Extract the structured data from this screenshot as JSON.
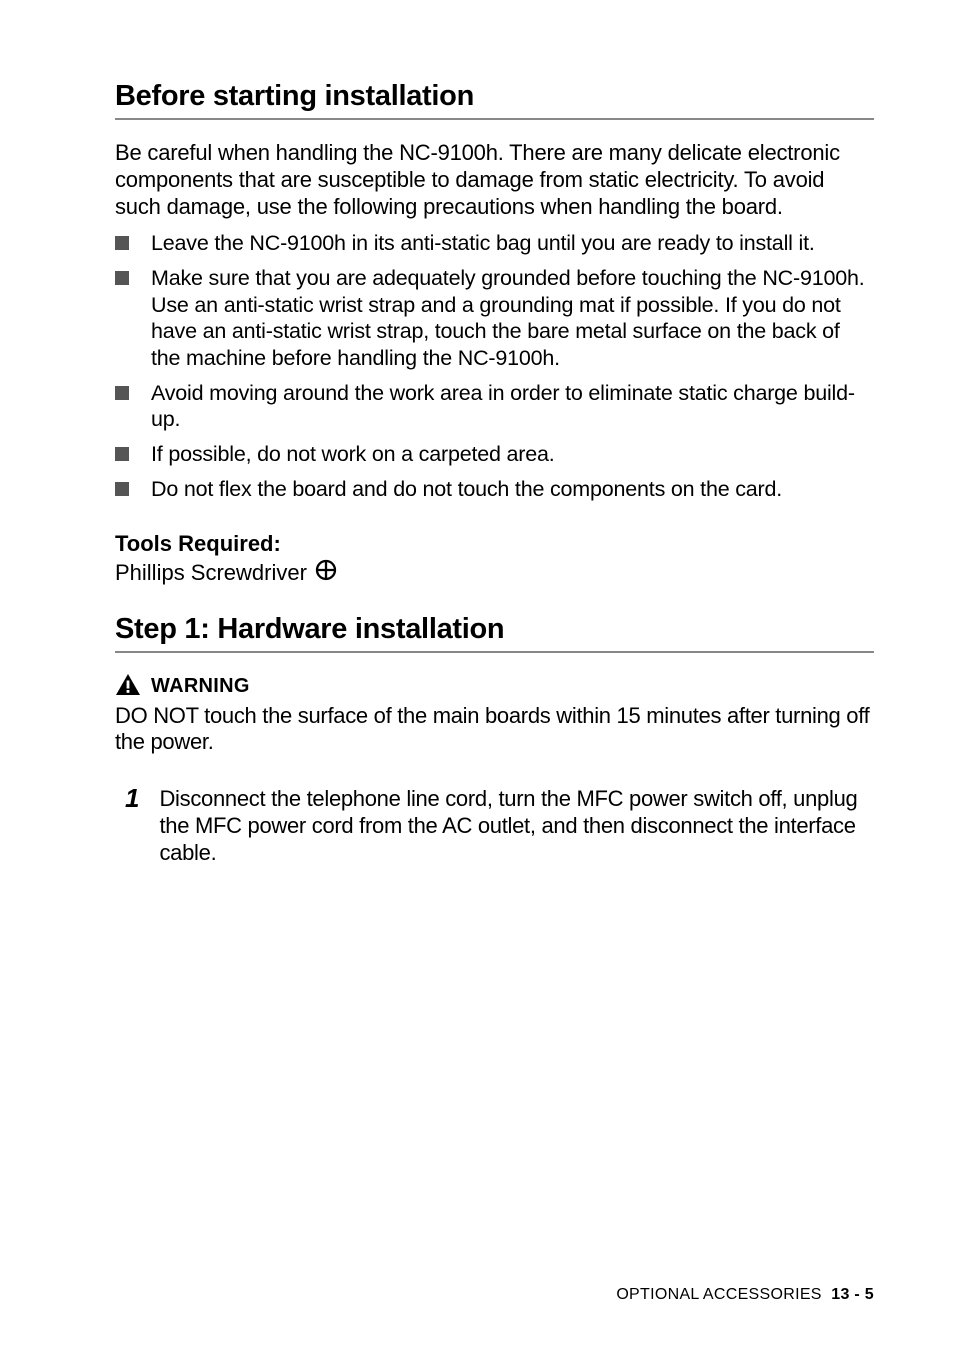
{
  "heading1": "Before starting installation",
  "intro": "Be careful when handling the NC-9100h. There are many delicate electronic components that are susceptible to damage from static electricity. To avoid such damage, use the following precautions when handling the board.",
  "bullets": [
    "Leave the NC-9100h in its anti-static bag until you are ready to install it.",
    "Make sure that you are adequately grounded before touching the NC-9100h. Use an anti-static wrist strap and a grounding mat if possible. If you do not have an anti-static wrist strap, touch the bare metal surface on the back of the machine before handling the NC-9100h.",
    "Avoid moving around the work area in order to eliminate static charge build-up.",
    "If possible, do not work on a carpeted area.",
    "Do not flex the board and do not touch the components on the card."
  ],
  "tools": {
    "label": "Tools Required:",
    "item": "Phillips Screwdriver"
  },
  "heading2": "Step 1: Hardware installation",
  "warning": {
    "label": "WARNING",
    "text": "DO NOT touch the surface of the main boards within 15 minutes after turning off the power."
  },
  "step": {
    "number": "1",
    "text": "Disconnect the telephone line cord, turn the MFC power switch off, unplug the MFC power cord from the AC outlet, and then disconnect the interface cable."
  },
  "footer": {
    "label": "OPTIONAL ACCESSORIES",
    "page": "13 - 5"
  }
}
